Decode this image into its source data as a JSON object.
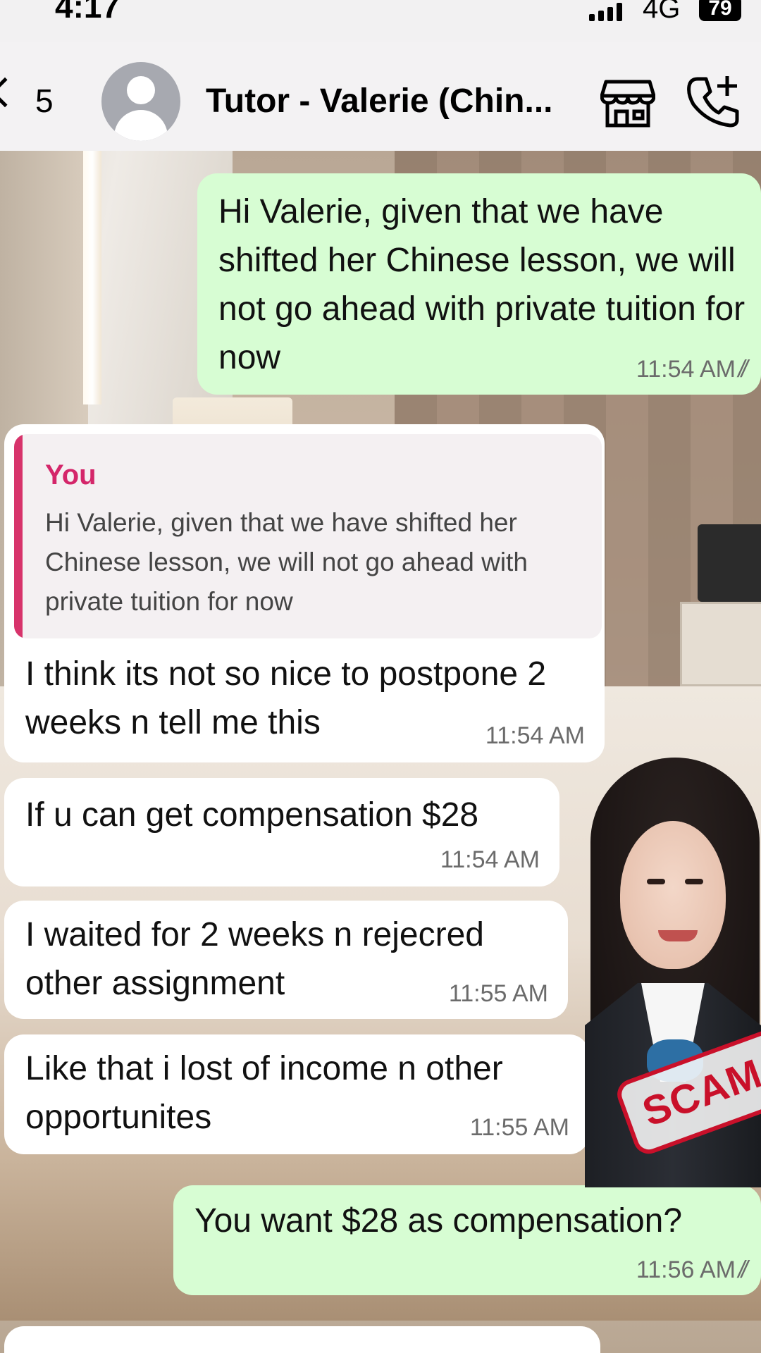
{
  "status_bar": {
    "time": "4:17",
    "network": "4G",
    "battery": "79"
  },
  "header": {
    "back_count": "5",
    "contact_name": "Tutor - Valerie (Chin...",
    "icons": [
      "back-chevron-icon",
      "avatar-icon",
      "store-icon",
      "call-add-icon"
    ]
  },
  "messages": [
    {
      "direction": "out",
      "text": "Hi Valerie, given that we have shifted her Chinese lesson, we will not go ahead with private tuition for now",
      "time": "11:54 AM",
      "read": true
    },
    {
      "direction": "in",
      "reply_to": {
        "author": "You",
        "text": "Hi Valerie, given that we have shifted her Chinese lesson, we will not go ahead with private tuition for now"
      },
      "text": "I think its not so nice to postpone 2 weeks n tell me this",
      "time": "11:54 AM"
    },
    {
      "direction": "in",
      "text": "If u can get compensation $28",
      "time": "11:54 AM"
    },
    {
      "direction": "in",
      "text": "I waited for 2 weeks n rejecred other assignment",
      "time": "11:55 AM"
    },
    {
      "direction": "in",
      "text": "Like that i lost of income n other opportunites",
      "time": "11:55 AM"
    },
    {
      "direction": "out",
      "text": "You want $28 as compensation?",
      "time": "11:56 AM",
      "read": true
    }
  ],
  "overlay": {
    "stamp_text": "SCAM AL"
  },
  "colors": {
    "outgoing_bubble": "#d7fdd3",
    "incoming_bubble": "#ffffff",
    "reply_accent": "#d4266a",
    "stamp_red": "#c9102a"
  }
}
